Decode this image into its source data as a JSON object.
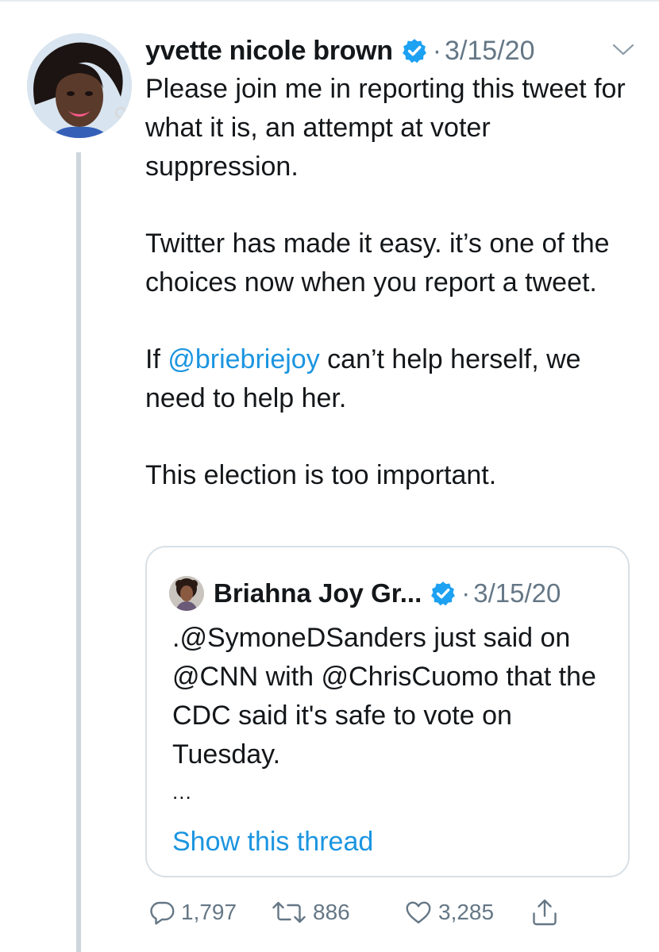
{
  "tweet": {
    "author_name": "yvette nicole brown",
    "separator": "·",
    "date": "3/15/20",
    "paragraphs": [
      "Please join me in reporting this tweet for what it is, an attempt at voter suppression.",
      "Twitter has made it easy. it’s one of the choices now when you report a tweet.",
      "This election is too important."
    ],
    "p3_before": "If ",
    "p3_mention": "@briebriejoy",
    "p3_after": " can’t help herself, we need to help her."
  },
  "quote": {
    "author_name": "Briahna Joy Gr...",
    "separator": "·",
    "date": "3/15/20",
    "text": ".@SymoneDSanders just said on @CNN with @ChrisCuomo that the CDC said it's safe to vote on Tuesday.",
    "ellipsis": "...",
    "show_thread": "Show this thread"
  },
  "actions": {
    "reply_count": "1,797",
    "retweet_count": "886",
    "like_count": "3,285"
  },
  "icons": {
    "verified": "verified-badge-icon",
    "chevron": "chevron-down-icon",
    "reply": "reply-icon",
    "retweet": "retweet-icon",
    "like": "heart-icon",
    "share": "share-icon"
  },
  "colors": {
    "link_blue": "#1b95e0",
    "muted_gray": "#657786",
    "text": "#14171a"
  }
}
